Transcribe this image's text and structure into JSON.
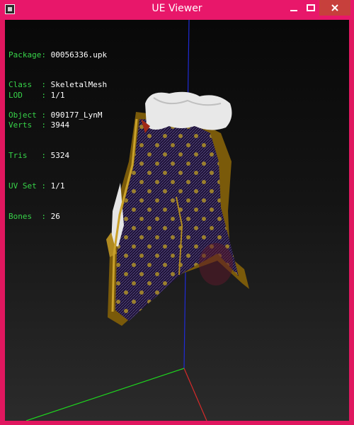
{
  "window": {
    "title": "UE Viewer"
  },
  "titlebar_buttons": [
    {
      "name": "minimize-button",
      "icon": "minimize-icon"
    },
    {
      "name": "maximize-button",
      "icon": "maximize-icon"
    },
    {
      "name": "close-button",
      "icon": "close-icon",
      "color": "#c7403c"
    }
  ],
  "info": {
    "package": {
      "label": "Package:",
      "value": "00056336.upk"
    },
    "class": {
      "label": "Class  :",
      "value": "SkeletalMesh"
    },
    "object": {
      "label": "Object :",
      "value": "090177_LynM"
    },
    "lod": {
      "label": "LOD    :",
      "value": "1/1"
    },
    "verts": {
      "label": "Verts  :",
      "value": "3944"
    },
    "tris": {
      "label": "Tris   :",
      "value": "5324"
    },
    "uvset": {
      "label": "UV Set :",
      "value": "1/1"
    },
    "bones": {
      "label": "Bones  :",
      "value": "26"
    }
  },
  "colors": {
    "accent": "#e8176a",
    "label_green": "#37d449",
    "axis_x": "#d62a2a",
    "axis_y": "#1ed61e",
    "axis_z": "#1f2bd6"
  }
}
